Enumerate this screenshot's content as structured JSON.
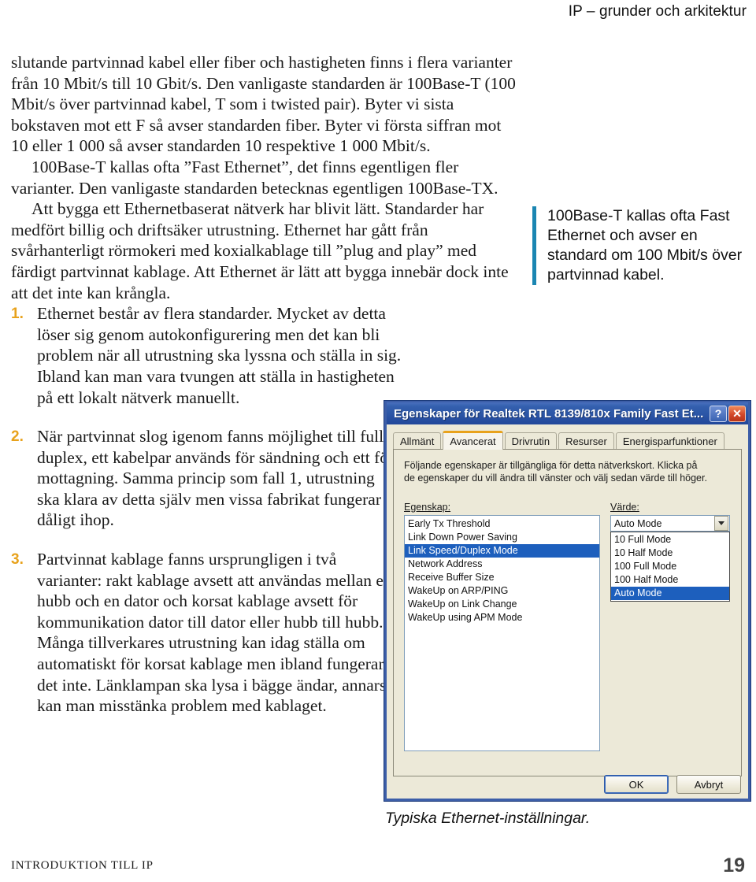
{
  "running_head": "IP – grunder och arkitektur",
  "body": {
    "paragraphs": [
      "slutande partvinnad kabel eller fiber och hastigheten finns i flera varianter från 10 Mbit/s till 10 Gbit/s. Den vanligaste standarden är 100Base-T (100 Mbit/s över partvinnad kabel, T som i twisted pair). Byter vi sista bokstaven mot ett F så avser standarden fiber. Byter vi första siffran mot 10 eller 1 000 så avser standarden 10 respektive 1 000 Mbit/s.",
      "100Base-T kallas ofta ”Fast Ethernet”, det finns egentligen fler varianter. Den vanligaste standarden betecknas egentligen 100Base-TX.",
      "Att bygga ett Ethernetbaserat nätverk har blivit lätt. Standarder har medfört billig och driftsäker utrustning. Ethernet har gått från svårhanterligt rörmokeri med koxialkablage till ”plug and play” med färdigt partvinnat kablage. Att Ethernet är lätt att bygga innebär dock inte att det inte kan krångla."
    ],
    "list": [
      {
        "number": "1.",
        "text": "Ethernet består av flera standarder. Mycket av detta löser sig genom autokonfigurering men det kan bli problem när all utrustning ska lyssna och ställa in sig. Ibland kan man vara tvungen att ställa in hastigheten på ett lokalt nätverk manuellt."
      },
      {
        "number": "2.",
        "text": "När partvinnat slog igenom fanns möjlighet till full duplex, ett kabelpar används för sändning och ett för mottagning. Samma princip som fall 1, utrustning ska klara av detta själv men vissa fabrikat fungerar dåligt ihop."
      },
      {
        "number": "3.",
        "text": "Partvinnat kablage fanns ursprungligen i två varianter: rakt kablage avsett att användas mellan en hubb och en dator och korsat kablage avsett för kommunikation dator till dator eller hubb till hubb. Många tillverkares utrustning kan idag ställa om automatiskt för korsat kablage men ibland fungerar det inte. Länklampan ska lysa i bägge ändar, annars kan man misstänka problem med kablaget."
      }
    ]
  },
  "pullquote": {
    "text": "100Base-T kallas ofta Fast Ethernet och avser en standard om 100 Mbit/s över partvinnad kabel.",
    "bar_color": "#1b86b2"
  },
  "dialog": {
    "title": "Egenskaper för Realtek RTL 8139/810x Family Fast Et...",
    "help_button": "?",
    "close_button": "✕",
    "tabs": [
      {
        "label": "Allmänt",
        "active": false
      },
      {
        "label": "Avancerat",
        "active": true
      },
      {
        "label": "Drivrutin",
        "active": false
      },
      {
        "label": "Resurser",
        "active": false
      },
      {
        "label": "Energisparfunktioner",
        "active": false
      }
    ],
    "description_line1": "Följande egenskaper är tillgängliga för detta nätverkskort. Klicka på",
    "description_line2": "de egenskaper du vill ändra till vänster och välj sedan värde till höger.",
    "property_label": "Egenskap:",
    "properties": [
      "Early Tx Threshold",
      "Link Down Power Saving",
      "Link Speed/Duplex Mode",
      "Network Address",
      "Receive Buffer Size",
      "WakeUp on ARP/PING",
      "WakeUp on Link Change",
      "WakeUp using APM Mode"
    ],
    "selected_property": "Link Speed/Duplex Mode",
    "value_label": "Värde:",
    "selected_value": "Auto Mode",
    "value_options": [
      "10 Full Mode",
      "10 Half Mode",
      "100 Full Mode",
      "100 Half Mode",
      "Auto Mode"
    ],
    "ok_button": "OK",
    "cancel_button": "Avbryt",
    "accent_tab_color": "#e8a21c",
    "selection_color": "#1d5fbd"
  },
  "figure_caption": "Typiska Ethernet-inställningar.",
  "footer": {
    "left": "INTRODUKTION TILL IP",
    "page": "19"
  }
}
